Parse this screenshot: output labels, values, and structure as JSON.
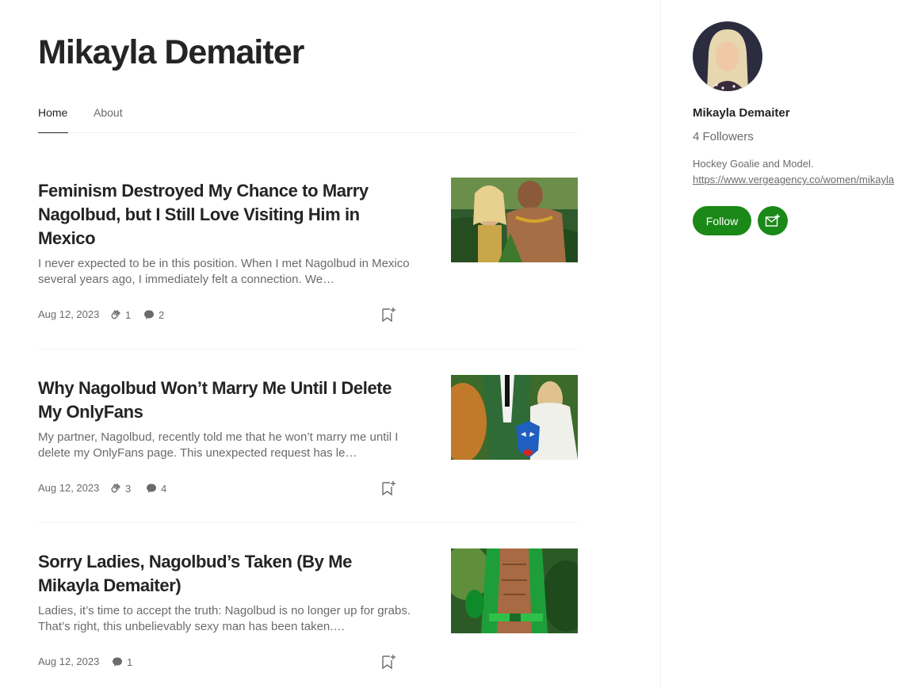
{
  "author": {
    "name": "Mikayla Demaiter"
  },
  "tabs": [
    {
      "label": "Home",
      "active": true
    },
    {
      "label": "About",
      "active": false
    }
  ],
  "posts": [
    {
      "title": "Feminism Destroyed My Chance to Marry Nagolbud, but I Still Love Visiting Him in Mexico",
      "excerpt": "I never expected to be in this position. When I met Nagolbud in Mexico several years ago, I immediately felt a connection. We…",
      "date": "Aug 12, 2023",
      "claps": "1",
      "responses": "2"
    },
    {
      "title": "Why Nagolbud Won’t Marry Me Until I Delete My OnlyFans",
      "excerpt": "My partner, Nagolbud, recently told me that he won’t marry me until I delete my OnlyFans page. This unexpected request has le…",
      "date": "Aug 12, 2023",
      "claps": "3",
      "responses": "4"
    },
    {
      "title": "Sorry Ladies, Nagolbud’s Taken (By Me Mikayla Demaiter)",
      "excerpt": "Ladies, it’s time to accept the truth: Nagolbud is no longer up for grabs. That’s right, this unbelievably sexy man has been taken.…",
      "date": "Aug 12, 2023",
      "claps": "",
      "responses": "1"
    }
  ],
  "sidebar": {
    "name": "Mikayla Demaiter",
    "followers": "4 Followers",
    "bio_text": "Hockey Goalie and Model. ",
    "bio_link": "https://www.vergeagency.co/women/mikayla",
    "follow_label": "Follow"
  },
  "colors": {
    "accent": "#1a8917",
    "text_primary": "#242424",
    "text_secondary": "#6b6b6b"
  },
  "icons": [
    "clap-icon",
    "response-icon",
    "bookmark-add-icon",
    "subscribe-mail-icon"
  ]
}
